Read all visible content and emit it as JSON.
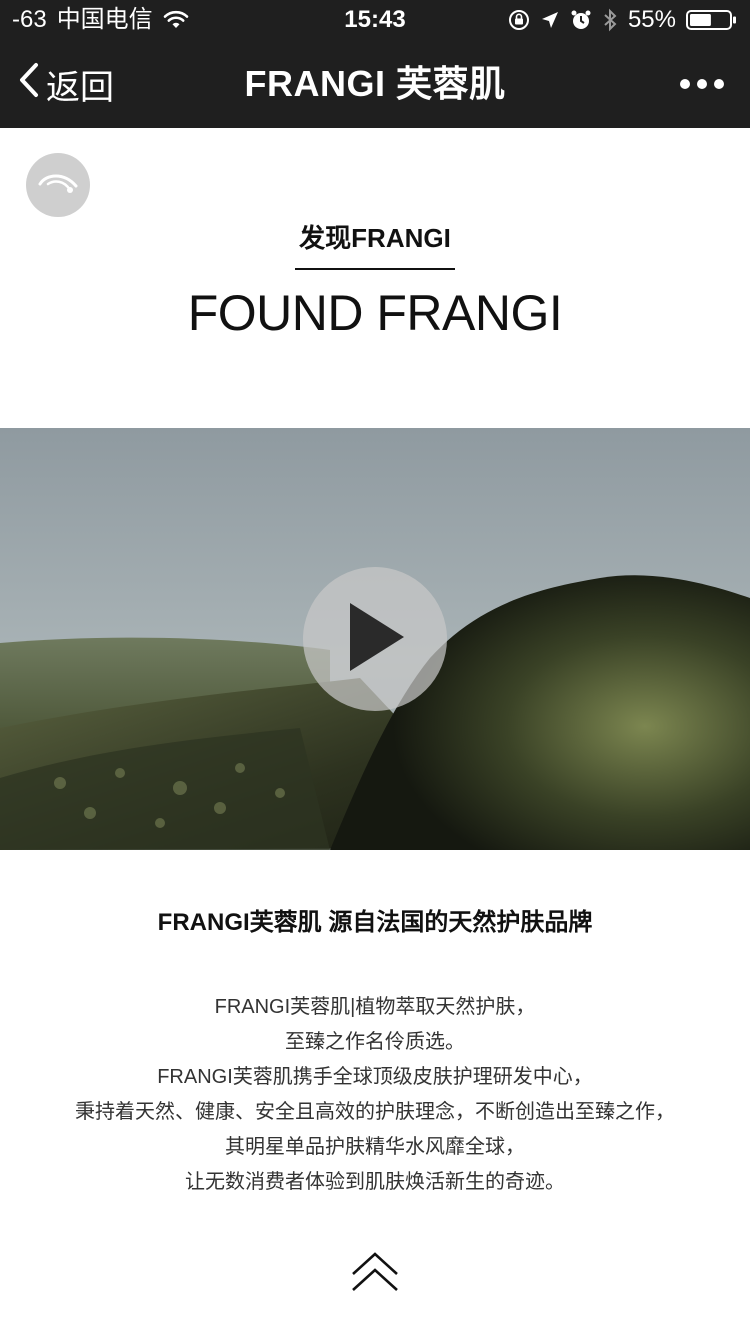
{
  "status_bar": {
    "signal": "-63",
    "carrier": "中国电信",
    "time": "15:43",
    "battery_percent": "55%",
    "battery_level": 0.55,
    "icons": [
      "wifi-icon",
      "lock-rotation-icon",
      "location-icon",
      "alarm-icon",
      "bluetooth-icon",
      "battery-icon"
    ]
  },
  "nav": {
    "back_label": "返回",
    "title": "FRANGI 芙蓉肌",
    "more_icon": "more-dots-icon"
  },
  "section": {
    "title": "发现FRANGI",
    "subtitle": "FOUND FRANGI"
  },
  "video": {
    "play_icon": "play-icon"
  },
  "brand_line": "FRANGI芙蓉肌 源自法国的天然护肤品牌",
  "description": {
    "lines": [
      "FRANGI芙蓉肌|植物萃取天然护肤，",
      "至臻之作名伶质选。",
      "FRANGI芙蓉肌携手全球顶级皮肤护理研发中心，",
      "秉持着天然、健康、安全且高效的护肤理念，不断创造出至臻之作，",
      "其明星单品护肤精华水风靡全球，",
      "让无数消费者体验到肌肤焕活新生的奇迹。"
    ]
  },
  "footer": {
    "arrow_icon": "double-chevron-up-icon"
  }
}
